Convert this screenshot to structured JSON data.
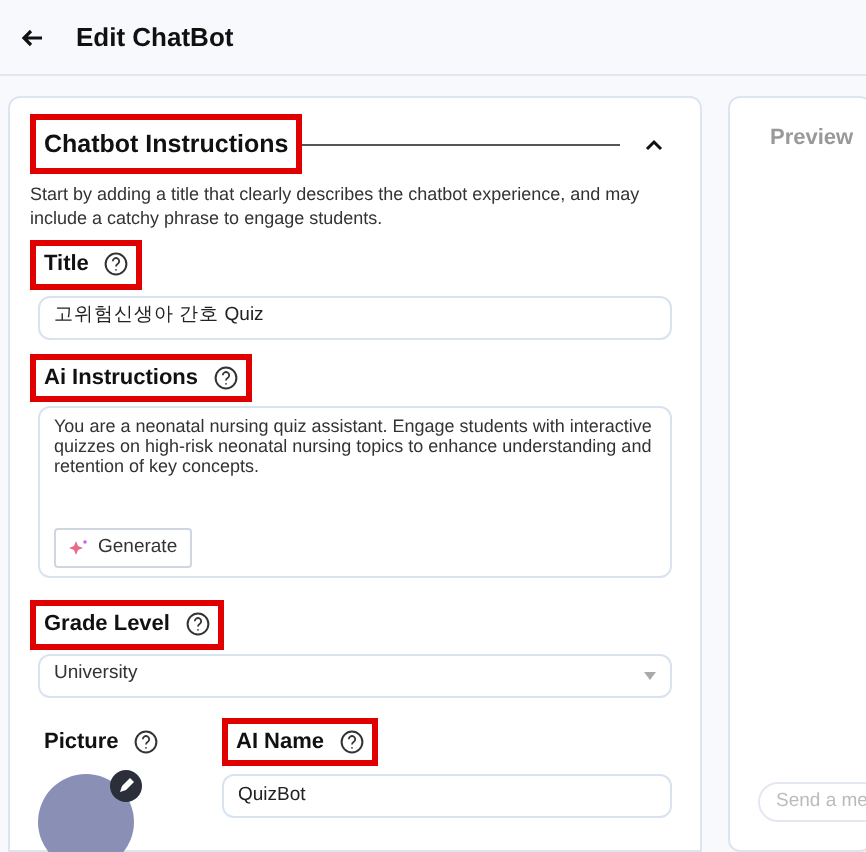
{
  "header": {
    "title": "Edit ChatBot"
  },
  "section": {
    "title": "Chatbot Instructions",
    "highlighted": true,
    "expanded": true,
    "description": "Start by adding a title that clearly describes the chatbot experience, and may include a catchy phrase to engage students."
  },
  "title_field": {
    "label": "Title",
    "highlighted": true,
    "value": "고위험신생아 간호 Quiz"
  },
  "instructions_field": {
    "label": "Ai Instructions",
    "highlighted": true,
    "value": "You are a neonatal nursing quiz assistant. Engage students with interactive quizzes on high-risk neonatal nursing topics to enhance understanding and retention of key concepts.",
    "generate_button": "Generate"
  },
  "grade_field": {
    "label": "Grade Level",
    "highlighted": true,
    "value": "University"
  },
  "picture_field": {
    "label": "Picture",
    "highlighted": false
  },
  "name_field": {
    "label": "AI Name",
    "highlighted": true,
    "value": "QuizBot"
  },
  "preview": {
    "title": "Preview",
    "message_placeholder": "Send a me"
  }
}
